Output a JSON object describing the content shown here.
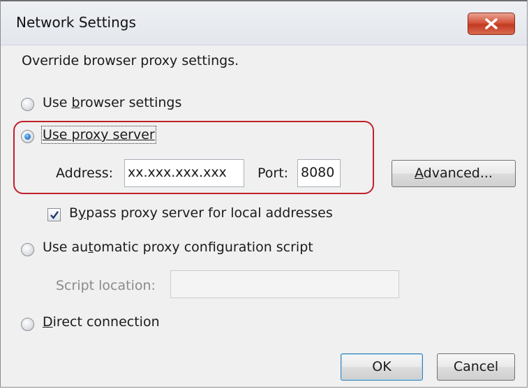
{
  "window": {
    "title": "Network Settings"
  },
  "header": {
    "description": "Override browser proxy settings."
  },
  "options": {
    "browser": {
      "pre": "Use ",
      "key": "b",
      "post": "rowser settings",
      "selected": false
    },
    "proxy": {
      "label": "Use proxy server",
      "selected": true
    },
    "auto": {
      "pre": "Use au",
      "key": "t",
      "post": "omatic proxy configuration script",
      "selected": false
    },
    "direct": {
      "key": "D",
      "post": "irect connection",
      "selected": false
    }
  },
  "proxy": {
    "address_label": "Address:",
    "address_value": "xx.xxx.xxx.xxx",
    "port_label": "Port:",
    "port_value": "8080",
    "advanced": {
      "key": "A",
      "post": "dvanced..."
    }
  },
  "bypass": {
    "pre": "B",
    "key": "y",
    "post": "pass proxy server for local addresses",
    "checked": true
  },
  "script": {
    "label": "Script location:",
    "value": ""
  },
  "buttons": {
    "ok": "OK",
    "cancel": "Cancel"
  },
  "colors": {
    "highlight": "#c0202a",
    "close": "#c94a31",
    "radio_selected": "#1d6fc4"
  },
  "icons": {
    "close": "close-icon",
    "check": "checkmark-icon"
  }
}
